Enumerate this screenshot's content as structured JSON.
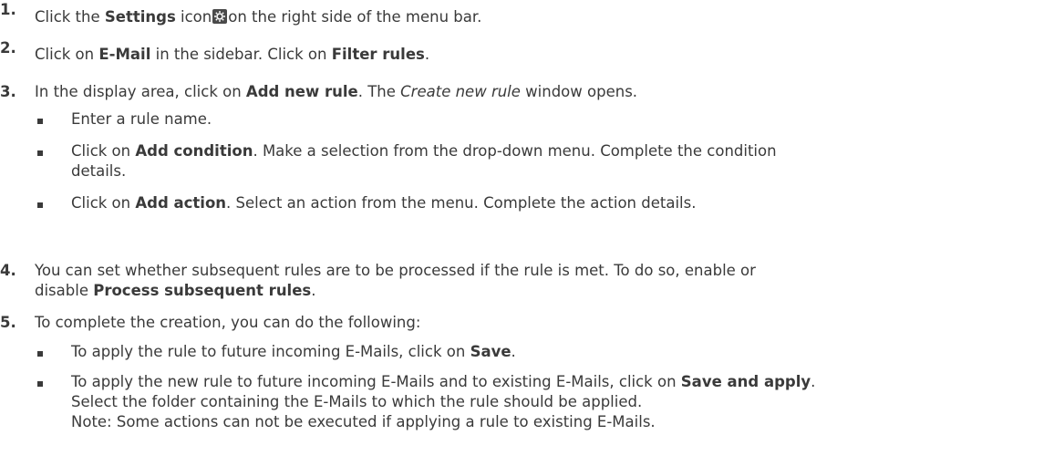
{
  "steps": [
    {
      "num": "1.",
      "parts": [
        "Click the ",
        "Settings",
        " icon",
        "on the right side of the menu bar."
      ],
      "icon": "gear-icon"
    },
    {
      "num": "2.",
      "parts": [
        "Click on ",
        "E-Mail",
        " in the sidebar. Click on ",
        "Filter rules",
        "."
      ]
    },
    {
      "num": "3.",
      "parts": [
        "In the display area, click on ",
        "Add new rule",
        ". The ",
        "Create new rule",
        " window opens."
      ],
      "bullets": [
        {
          "lines": [
            [
              "Enter a rule name."
            ]
          ]
        },
        {
          "lines": [
            [
              "Click on ",
              "Add condition",
              ". Make a selection from the drop-down menu. Complete the condition"
            ],
            [
              "details."
            ]
          ]
        },
        {
          "lines": [
            [
              "Click on ",
              "Add action",
              ". Select an action from the menu. Complete the action details."
            ]
          ]
        }
      ]
    },
    {
      "num": "4.",
      "lines": [
        [
          "You can set whether subsequent rules are to be processed if the rule is met. To do so, enable or"
        ],
        [
          "disable ",
          "Process subsequent rules",
          "."
        ]
      ]
    },
    {
      "num": "5.",
      "parts": [
        "To complete the creation, you can do the following:"
      ],
      "bullets": [
        {
          "lines": [
            [
              "To apply the rule to future incoming E-Mails, click on ",
              "Save",
              "."
            ]
          ]
        },
        {
          "lines": [
            [
              "To apply the new rule to future incoming E-Mails and to existing E-Mails, click on ",
              "Save and apply",
              "."
            ],
            [
              "Select the folder containing the E-Mails to which the rule should be applied."
            ],
            [
              "Note: Some actions can not be executed if applying a rule to existing E-Mails."
            ]
          ]
        }
      ]
    }
  ]
}
